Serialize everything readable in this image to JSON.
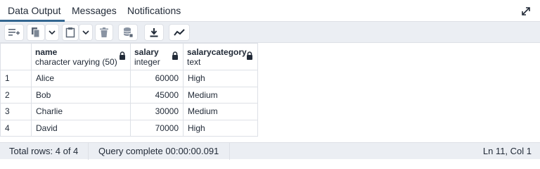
{
  "tabs": [
    {
      "label": "Data Output",
      "active": true
    },
    {
      "label": "Messages",
      "active": false
    },
    {
      "label": "Notifications",
      "active": false
    }
  ],
  "toolbar": {
    "buttons": [
      {
        "icon": "add-row-icon"
      },
      {
        "icon": "copy-icon"
      },
      {
        "icon": "chevron-down-icon"
      },
      {
        "icon": "paste-icon"
      },
      {
        "icon": "chevron-down-icon"
      },
      {
        "icon": "delete-icon"
      },
      {
        "icon": "save-data-icon"
      },
      {
        "icon": "download-icon"
      },
      {
        "icon": "graph-icon"
      }
    ]
  },
  "grid": {
    "columns": [
      {
        "name": "name",
        "type": "character varying (50)",
        "locked": true
      },
      {
        "name": "salary",
        "type": "integer",
        "locked": true
      },
      {
        "name": "salarycategory",
        "type": "text",
        "locked": true
      }
    ],
    "rows": [
      {
        "num": "1",
        "cells": [
          "Alice",
          "60000",
          "High"
        ]
      },
      {
        "num": "2",
        "cells": [
          "Bob",
          "45000",
          "Medium"
        ]
      },
      {
        "num": "3",
        "cells": [
          "Charlie",
          "30000",
          "Medium"
        ]
      },
      {
        "num": "4",
        "cells": [
          "David",
          "70000",
          "High"
        ]
      }
    ]
  },
  "status": {
    "total_rows": "Total rows: 4 of 4",
    "query": "Query complete 00:00:00.091",
    "position": "Ln 11, Col 1"
  },
  "colors": {
    "accent": "#326690",
    "toolbar_bg": "#ebeef3",
    "border": "#dde0e6",
    "text": "#222b38"
  }
}
